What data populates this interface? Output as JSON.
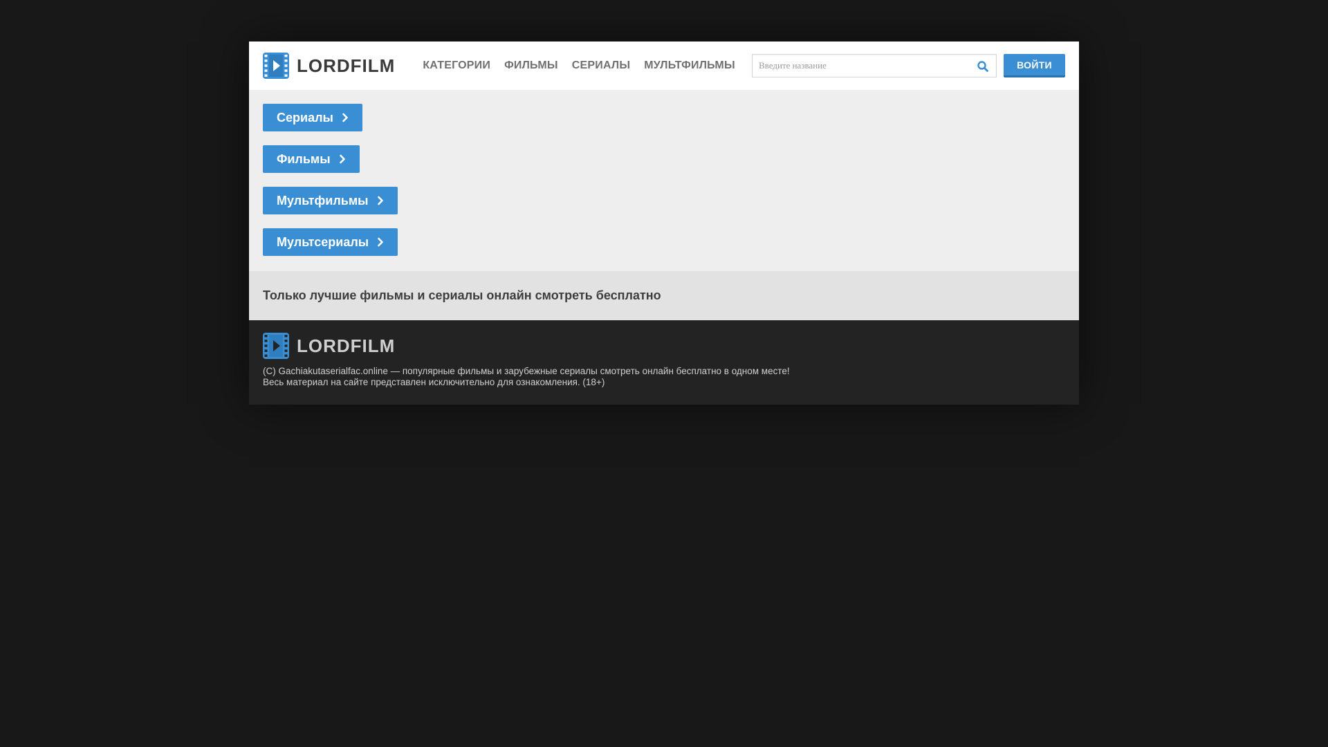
{
  "brand": {
    "name": "LORDFILM",
    "accent_color": "#3a8fd4"
  },
  "header": {
    "nav": [
      {
        "label": "КАТЕГОРИИ"
      },
      {
        "label": "ФИЛЬМЫ"
      },
      {
        "label": "СЕРИАЛЫ"
      },
      {
        "label": "МУЛЬТФИЛЬМЫ"
      }
    ],
    "search": {
      "placeholder": "Введите название",
      "value": "",
      "icon": "search-icon"
    },
    "login_label": "ВОЙТИ"
  },
  "categories": [
    {
      "label": "Сериалы"
    },
    {
      "label": "Фильмы"
    },
    {
      "label": "Мультфильмы"
    },
    {
      "label": "Мультсериалы"
    }
  ],
  "tagline": "Только лучшие фильмы и сериалы онлайн смотреть бесплатно",
  "footer": {
    "logo_text": "LORDFILM",
    "line1": "(C) Gachiakutaserialfac.online — популярные фильмы и зарубежные сериалы смотреть онлайн бесплатно в одном месте!",
    "line2": "Весь материал на сайте представлен исключительно для ознакомления. (18+)"
  }
}
